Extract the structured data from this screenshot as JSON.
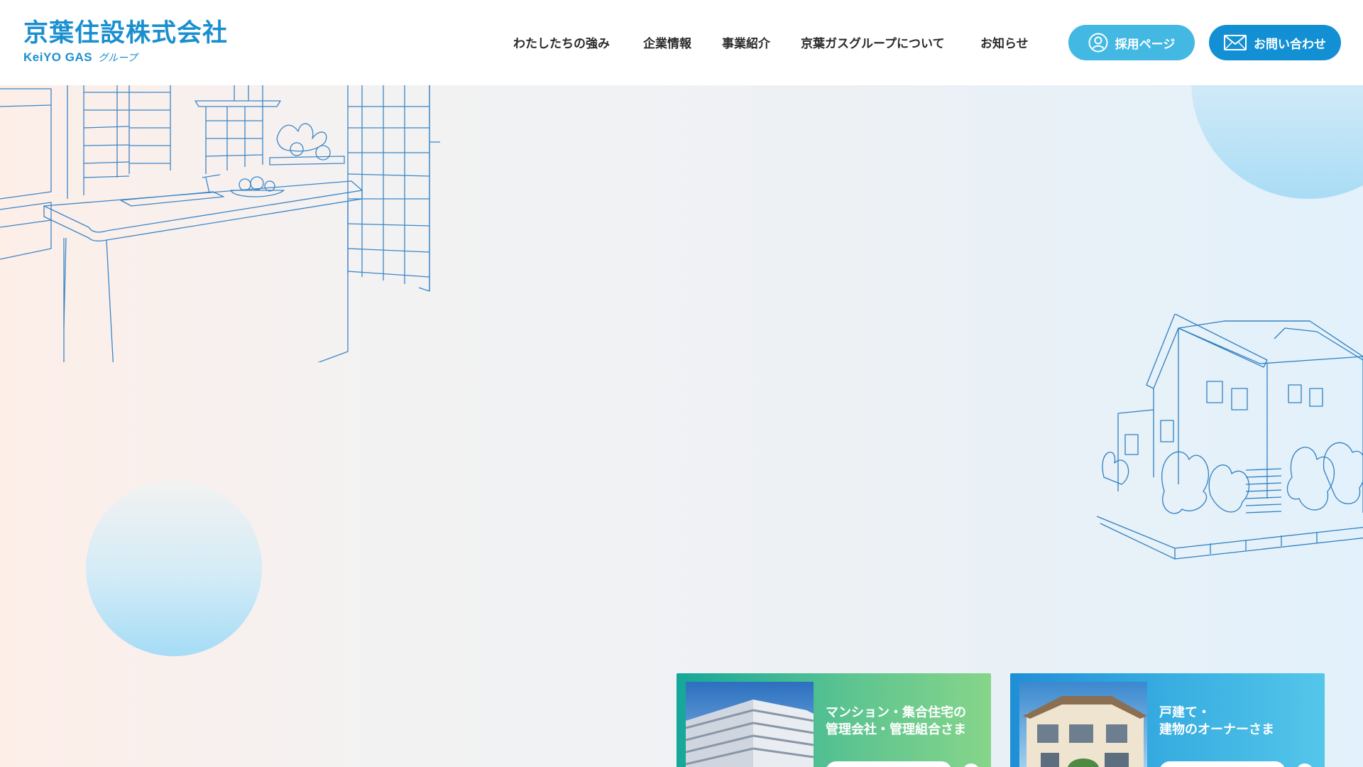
{
  "header": {
    "logo": {
      "name": "京葉住設株式会社",
      "brand": "KeiYO GAS",
      "group": "グループ"
    },
    "nav": [
      {
        "label": "わたしたちの強み"
      },
      {
        "label": "企業情報"
      },
      {
        "label": "事業紹介"
      },
      {
        "label": "京葉ガスグループについて"
      },
      {
        "label": "お知らせ"
      }
    ],
    "recruit_button": {
      "label": "採用ページ",
      "icon": "person-icon"
    },
    "contact_button": {
      "label": "お問い合わせ",
      "icon": "mail-icon"
    }
  },
  "cards": [
    {
      "line1": "マンション・集合住宅の",
      "line2": "管理会社・管理組合さま"
    },
    {
      "line1": "戸建て・",
      "line2": "建物のオーナーさま"
    }
  ],
  "colors": {
    "brand_blue": "#1a8fd0",
    "recruit_button": "#42b8e3",
    "contact_button": "#1390d4",
    "card_green": "#5dc490",
    "card_blue": "#3ab0e2"
  }
}
